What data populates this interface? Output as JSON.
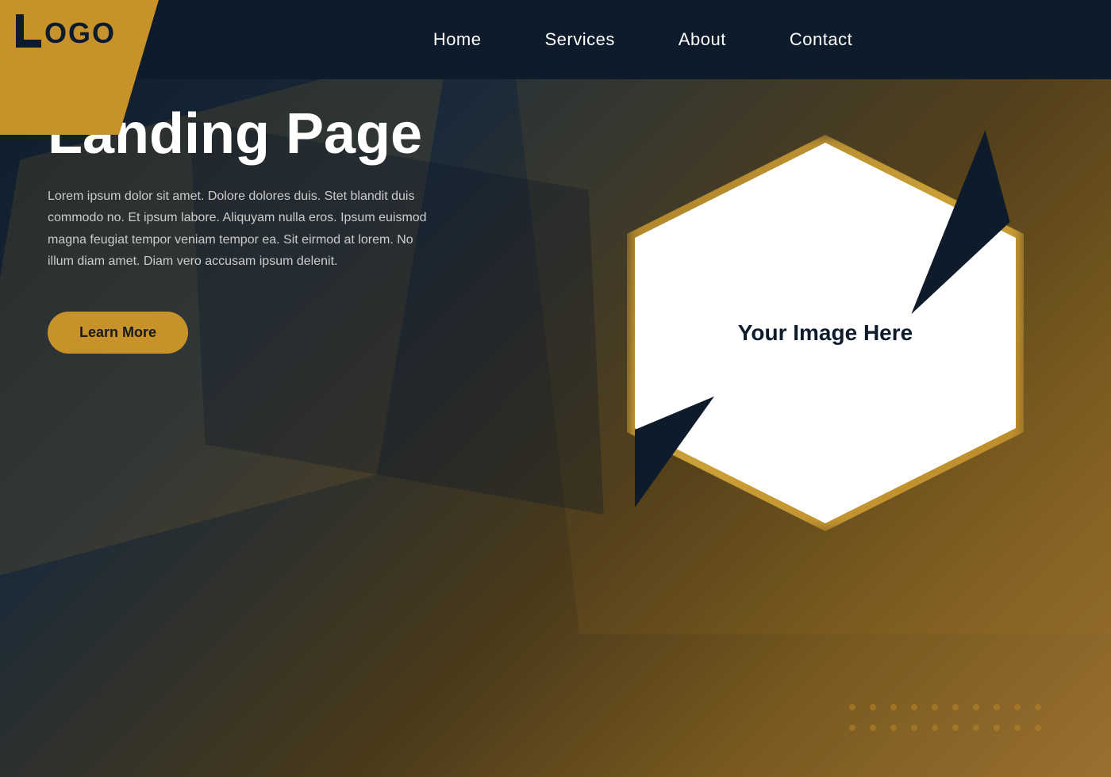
{
  "logo": {
    "l_char": "L",
    "ogo_char": "OGO",
    "full_text": "LOGO"
  },
  "navbar": {
    "links": [
      {
        "id": "home",
        "label": "Home"
      },
      {
        "id": "services",
        "label": "Services"
      },
      {
        "id": "about",
        "label": "About"
      },
      {
        "id": "contact",
        "label": "Contact"
      }
    ]
  },
  "hero": {
    "title": "Landing Page",
    "description": "Lorem ipsum dolor sit amet. Dolore dolores duis. Stet blandit duis commodo no. Et ipsum labore. Aliquyam nulla eros. Ipsum euismod magna feugiat tempor veniam tempor ea. Sit eirmod at lorem. No illum diam amet. Diam vero accusam ipsum delenit.",
    "cta_label": "Learn More",
    "image_placeholder": "Your Image Here"
  },
  "colors": {
    "gold": "#c8922a",
    "dark_navy": "#0d1b2a",
    "white": "#ffffff"
  }
}
